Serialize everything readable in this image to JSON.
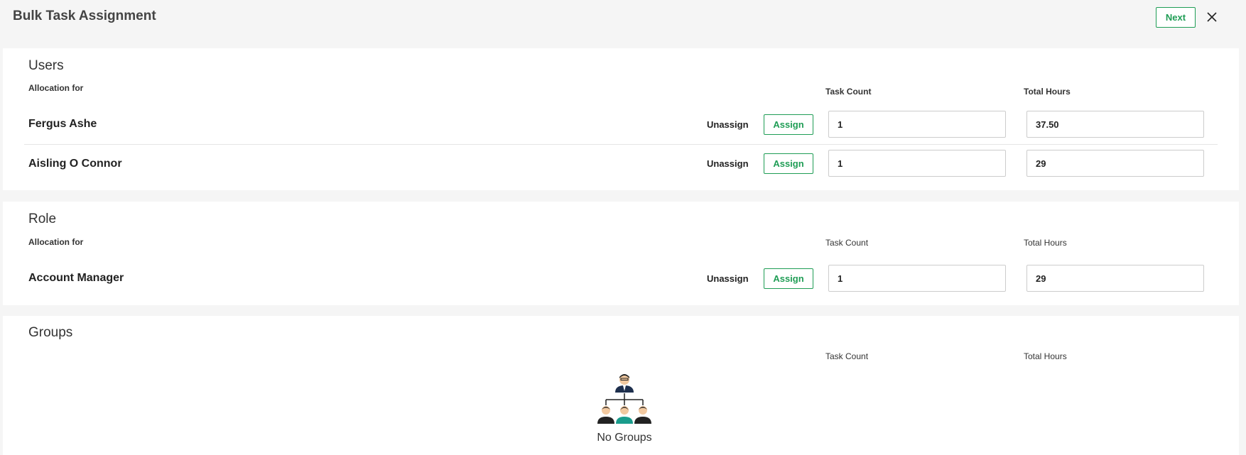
{
  "header": {
    "title": "Bulk Task Assignment",
    "next_label": "Next"
  },
  "users": {
    "title": "Users",
    "allocation_label": "Allocation for",
    "task_count_label": "Task Count",
    "total_hours_label": "Total Hours",
    "rows": [
      {
        "name": "Fergus Ashe",
        "unassign_label": "Unassign",
        "assign_label": "Assign",
        "task_count": "1",
        "total_hours": "37.50"
      },
      {
        "name": "Aisling O Connor",
        "unassign_label": "Unassign",
        "assign_label": "Assign",
        "task_count": "1",
        "total_hours": "29"
      }
    ]
  },
  "role": {
    "title": "Role",
    "allocation_label": "Allocation for",
    "task_count_label": "Task Count",
    "total_hours_label": "Total Hours",
    "rows": [
      {
        "name": "Account Manager",
        "unassign_label": "Unassign",
        "assign_label": "Assign",
        "task_count": "1",
        "total_hours": "29"
      }
    ]
  },
  "groups": {
    "title": "Groups",
    "task_count_label": "Task Count",
    "total_hours_label": "Total Hours",
    "empty_label": "No Groups"
  },
  "colors": {
    "accent": "#1f9d55",
    "teal": "#1a9c8c",
    "navy": "#1e2f4d"
  },
  "icons": {
    "close": "close-icon",
    "empty": "org-chart-icon"
  }
}
